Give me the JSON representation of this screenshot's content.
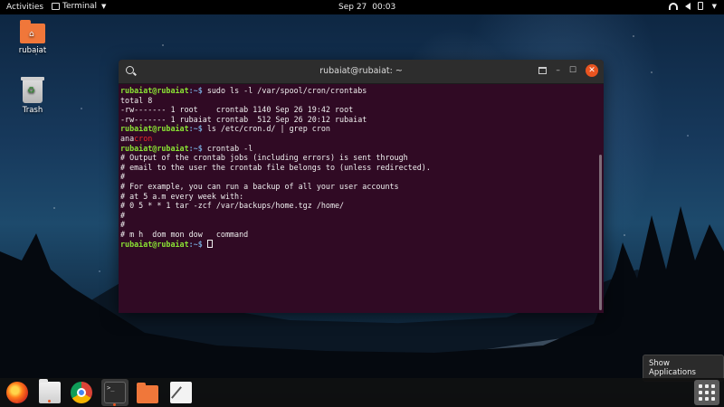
{
  "topbar": {
    "activities": "Activities",
    "app_menu": "Terminal",
    "date": "Sep 27",
    "time": "00:03"
  },
  "desktop": {
    "icons": [
      {
        "label": "rubaiat",
        "icon": "home-folder-icon"
      },
      {
        "label": "Trash",
        "icon": "trash-icon"
      }
    ]
  },
  "terminal": {
    "title": "rubaiat@rubaiat: ~",
    "prompt_user": "rubaiat@rubaiat",
    "prompt_path": ":~$",
    "lines": {
      "cmd1": " sudo ls -l /var/spool/cron/crontabs",
      "l2": "total 8",
      "l3": "-rw------- 1 root    crontab 1140 Sep 26 19:42 root",
      "l4": "-rw------- 1 rubaiat crontab  512 Sep 26 20:12 rubaiat",
      "cmd2": " ls /etc/cron.d/ | grep cron",
      "l6a": "ana",
      "l6b": "cron",
      "cmd3": " crontab -l",
      "l8": "# Output of the crontab jobs (including errors) is sent through",
      "l9": "# email to the user the crontab file belongs to (unless redirected).",
      "l10": "#",
      "l11": "# For example, you can run a backup of all your user accounts",
      "l12": "# at 5 a.m every week with:",
      "l13": "# 0 5 * * 1 tar -zcf /var/backups/home.tgz /home/",
      "l14": "#",
      "l15": "#",
      "l16": "# m h  dom mon dow   command",
      "cmd4": " "
    }
  },
  "tooltip": "Show Applications",
  "dock": {
    "items": [
      "firefox-icon",
      "files-icon",
      "chrome-icon",
      "terminal-icon",
      "folder-icon",
      "text-editor-icon",
      "show-applications-icon"
    ],
    "terminal_glyph": ">_"
  },
  "colors": {
    "terminal_bg": "#300a24",
    "prompt_user": "#8ae234",
    "prompt_path": "#729fcf",
    "accent": "#e95420"
  }
}
